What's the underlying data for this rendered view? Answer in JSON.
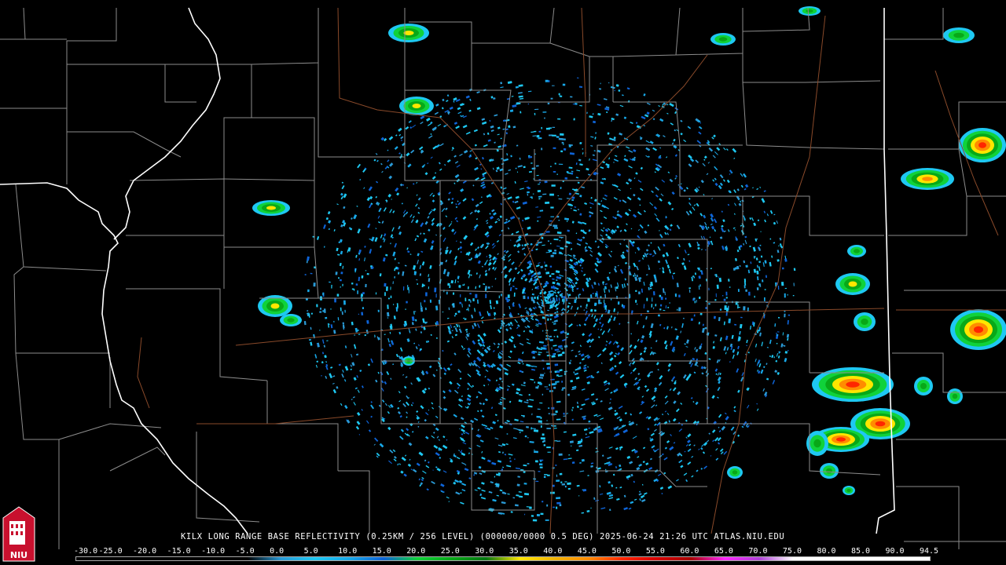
{
  "caption": "KILX LONG RANGE BASE REFLECTIVITY (0.25KM / 256 LEVEL) (000000/0000 0.5 DEG) 2025-06-24 21:26 UTC  ATLAS.NIU.EDU",
  "logo_text": "NIU",
  "legend": {
    "labels": [
      "-30.0",
      "-25.0",
      "-20.0",
      "-15.0",
      "-10.0",
      "-5.0",
      "0.0",
      "5.0",
      "10.0",
      "15.0",
      "20.0",
      "25.0",
      "30.0",
      "35.0",
      "40.0",
      "45.0",
      "50.0",
      "55.0",
      "60.0",
      "65.0",
      "70.0",
      "75.0",
      "80.0",
      "85.0",
      "90.0",
      "94.5"
    ],
    "colors": [
      "#000000",
      "#000000",
      "#000000",
      "#000000",
      "#000000",
      "#000000",
      "#2a9ad6",
      "#1ec8f2",
      "#18a8e8",
      "#0e64d8",
      "#10d23a",
      "#08a818",
      "#067812",
      "#ffe600",
      "#f0b400",
      "#ff8c00",
      "#ff2600",
      "#d80000",
      "#a80000",
      "#ff28ff",
      "#b040d8",
      "#ffffff",
      "#ffffff",
      "#ffffff",
      "#ffffff",
      "#ffffff"
    ]
  },
  "map_colors": {
    "background": "#000000",
    "county_lines": "#8c8c8c",
    "state_lines": "#ffffff",
    "highways": "#8a4a2a"
  }
}
